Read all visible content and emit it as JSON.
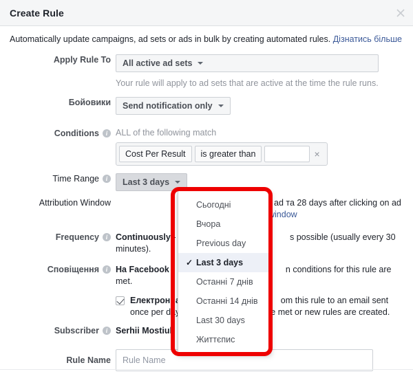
{
  "dialog": {
    "title": "Create Rule",
    "close_icon": "close-icon",
    "intro_text": "Automatically update campaigns, ad sets or ads in bulk by creating automated rules.",
    "intro_link": "Дізнатись більше"
  },
  "apply_rule_to": {
    "label": "Apply Rule To",
    "value": "All active ad sets",
    "helper": "Your rule will apply to ad sets that are active at the time the rule runs."
  },
  "action": {
    "label": "Бойовики",
    "value": "Send notification only"
  },
  "conditions": {
    "label": "Conditions",
    "info_icon": "info-icon",
    "match_text": "ALL of the following match",
    "metric": "Cost Per Result",
    "operator": "is greater than",
    "value": "",
    "value_placeholder": "",
    "remove_icon": "×"
  },
  "time_range": {
    "label": "Time Range",
    "info_icon": "info-icon",
    "value": "Last 3 days",
    "options": [
      {
        "label": "Сьогодні",
        "selected": false
      },
      {
        "label": "Вчора",
        "selected": false
      },
      {
        "label": "Previous day",
        "selected": false
      },
      {
        "label": "Last 3 days",
        "selected": true
      },
      {
        "label": "Останні 7 днів",
        "selected": false
      },
      {
        "label": "Останні 14 днів",
        "selected": false
      },
      {
        "label": "Last 30 days",
        "selected": false
      },
      {
        "label": "Життєпис",
        "selected": false
      }
    ],
    "check_glyph": "✓"
  },
  "attribution_window": {
    "label": "Attribution Window",
    "text_tail": "ad та 28 days after clicking on ad",
    "link_tail": "window"
  },
  "frequency": {
    "label": "Frequency",
    "info_icon": "info-icon",
    "strong": "Continuously",
    "text_head": " - ",
    "text_tail": "s possible (usually every 30 minutes)."
  },
  "notification": {
    "label": "Сповіщення",
    "info_icon": "info-icon",
    "facebook_strong": "На Facebook",
    "facebook_tail": "n conditions for this rule are met.",
    "email_checked": true,
    "email_strong": "Електронна",
    "email_tail": "om this rule to an email sent once per day when conditions that are met or new rules are created."
  },
  "subscriber": {
    "label": "Subscriber",
    "info_icon": "info-icon",
    "value": "Serhii Mostiuk"
  },
  "rule_name": {
    "label": "Rule Name",
    "value": "",
    "placeholder": "Rule Name"
  },
  "annotation": {
    "highlight_color": "#ee0000",
    "name": "red-highlight-box"
  }
}
